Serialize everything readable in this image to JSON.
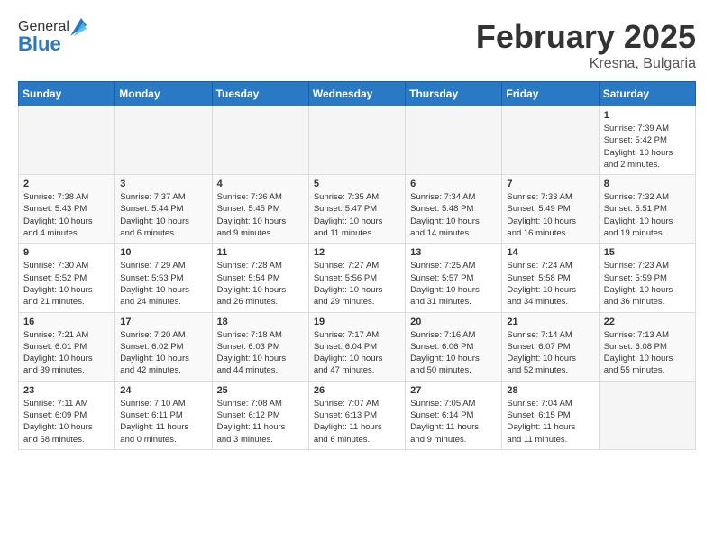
{
  "header": {
    "logo": {
      "general": "General",
      "blue": "Blue"
    },
    "month_title": "February 2025",
    "location": "Kresna, Bulgaria"
  },
  "weekdays": [
    "Sunday",
    "Monday",
    "Tuesday",
    "Wednesday",
    "Thursday",
    "Friday",
    "Saturday"
  ],
  "weeks": [
    [
      {
        "day": "",
        "info": ""
      },
      {
        "day": "",
        "info": ""
      },
      {
        "day": "",
        "info": ""
      },
      {
        "day": "",
        "info": ""
      },
      {
        "day": "",
        "info": ""
      },
      {
        "day": "",
        "info": ""
      },
      {
        "day": "1",
        "info": "Sunrise: 7:39 AM\nSunset: 5:42 PM\nDaylight: 10 hours\nand 2 minutes."
      }
    ],
    [
      {
        "day": "2",
        "info": "Sunrise: 7:38 AM\nSunset: 5:43 PM\nDaylight: 10 hours\nand 4 minutes."
      },
      {
        "day": "3",
        "info": "Sunrise: 7:37 AM\nSunset: 5:44 PM\nDaylight: 10 hours\nand 6 minutes."
      },
      {
        "day": "4",
        "info": "Sunrise: 7:36 AM\nSunset: 5:45 PM\nDaylight: 10 hours\nand 9 minutes."
      },
      {
        "day": "5",
        "info": "Sunrise: 7:35 AM\nSunset: 5:47 PM\nDaylight: 10 hours\nand 11 minutes."
      },
      {
        "day": "6",
        "info": "Sunrise: 7:34 AM\nSunset: 5:48 PM\nDaylight: 10 hours\nand 14 minutes."
      },
      {
        "day": "7",
        "info": "Sunrise: 7:33 AM\nSunset: 5:49 PM\nDaylight: 10 hours\nand 16 minutes."
      },
      {
        "day": "8",
        "info": "Sunrise: 7:32 AM\nSunset: 5:51 PM\nDaylight: 10 hours\nand 19 minutes."
      }
    ],
    [
      {
        "day": "9",
        "info": "Sunrise: 7:30 AM\nSunset: 5:52 PM\nDaylight: 10 hours\nand 21 minutes."
      },
      {
        "day": "10",
        "info": "Sunrise: 7:29 AM\nSunset: 5:53 PM\nDaylight: 10 hours\nand 24 minutes."
      },
      {
        "day": "11",
        "info": "Sunrise: 7:28 AM\nSunset: 5:54 PM\nDaylight: 10 hours\nand 26 minutes."
      },
      {
        "day": "12",
        "info": "Sunrise: 7:27 AM\nSunset: 5:56 PM\nDaylight: 10 hours\nand 29 minutes."
      },
      {
        "day": "13",
        "info": "Sunrise: 7:25 AM\nSunset: 5:57 PM\nDaylight: 10 hours\nand 31 minutes."
      },
      {
        "day": "14",
        "info": "Sunrise: 7:24 AM\nSunset: 5:58 PM\nDaylight: 10 hours\nand 34 minutes."
      },
      {
        "day": "15",
        "info": "Sunrise: 7:23 AM\nSunset: 5:59 PM\nDaylight: 10 hours\nand 36 minutes."
      }
    ],
    [
      {
        "day": "16",
        "info": "Sunrise: 7:21 AM\nSunset: 6:01 PM\nDaylight: 10 hours\nand 39 minutes."
      },
      {
        "day": "17",
        "info": "Sunrise: 7:20 AM\nSunset: 6:02 PM\nDaylight: 10 hours\nand 42 minutes."
      },
      {
        "day": "18",
        "info": "Sunrise: 7:18 AM\nSunset: 6:03 PM\nDaylight: 10 hours\nand 44 minutes."
      },
      {
        "day": "19",
        "info": "Sunrise: 7:17 AM\nSunset: 6:04 PM\nDaylight: 10 hours\nand 47 minutes."
      },
      {
        "day": "20",
        "info": "Sunrise: 7:16 AM\nSunset: 6:06 PM\nDaylight: 10 hours\nand 50 minutes."
      },
      {
        "day": "21",
        "info": "Sunrise: 7:14 AM\nSunset: 6:07 PM\nDaylight: 10 hours\nand 52 minutes."
      },
      {
        "day": "22",
        "info": "Sunrise: 7:13 AM\nSunset: 6:08 PM\nDaylight: 10 hours\nand 55 minutes."
      }
    ],
    [
      {
        "day": "23",
        "info": "Sunrise: 7:11 AM\nSunset: 6:09 PM\nDaylight: 10 hours\nand 58 minutes."
      },
      {
        "day": "24",
        "info": "Sunrise: 7:10 AM\nSunset: 6:11 PM\nDaylight: 11 hours\nand 0 minutes."
      },
      {
        "day": "25",
        "info": "Sunrise: 7:08 AM\nSunset: 6:12 PM\nDaylight: 11 hours\nand 3 minutes."
      },
      {
        "day": "26",
        "info": "Sunrise: 7:07 AM\nSunset: 6:13 PM\nDaylight: 11 hours\nand 6 minutes."
      },
      {
        "day": "27",
        "info": "Sunrise: 7:05 AM\nSunset: 6:14 PM\nDaylight: 11 hours\nand 9 minutes."
      },
      {
        "day": "28",
        "info": "Sunrise: 7:04 AM\nSunset: 6:15 PM\nDaylight: 11 hours\nand 11 minutes."
      },
      {
        "day": "",
        "info": ""
      }
    ]
  ]
}
